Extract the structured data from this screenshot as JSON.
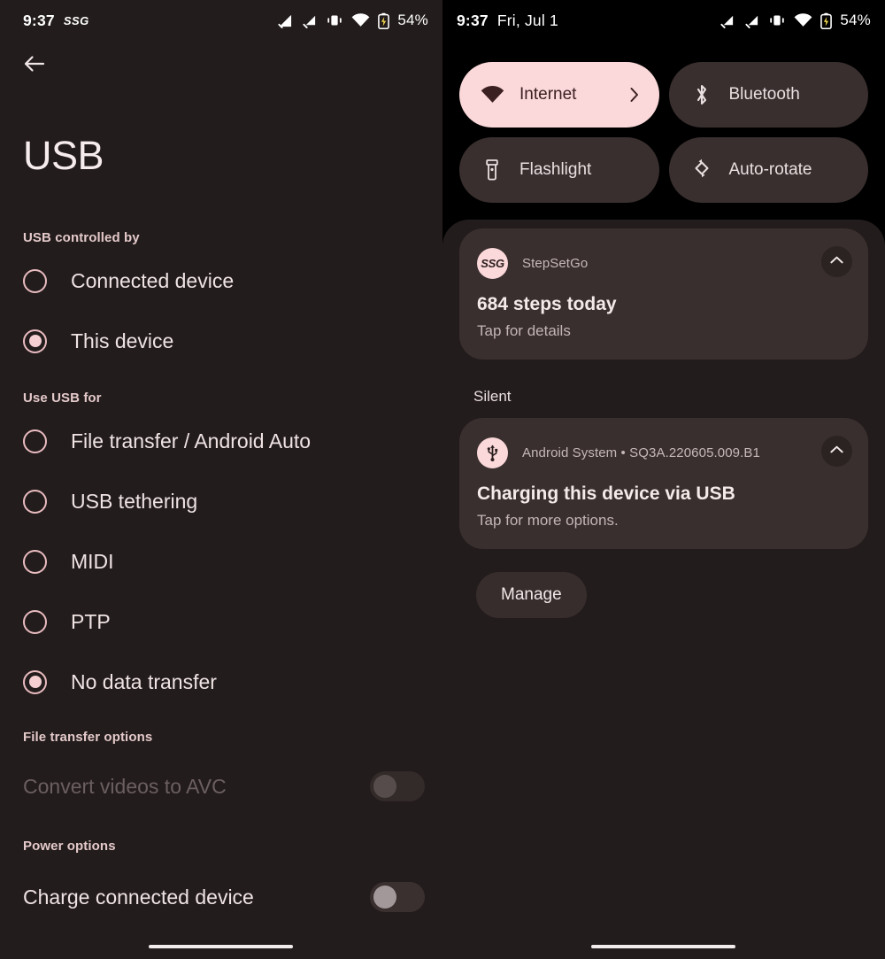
{
  "left": {
    "statusbar": {
      "time": "9:37",
      "app_badge": "SSG",
      "battery": "54%",
      "icons": [
        "signal-icon",
        "signal-icon",
        "vibrate-icon",
        "wifi-icon",
        "battery-charging-icon"
      ]
    },
    "back_icon": "arrow-back-icon",
    "title": "USB",
    "sections": [
      {
        "label": "USB controlled by",
        "options": [
          {
            "label": "Connected device",
            "checked": false
          },
          {
            "label": "This device",
            "checked": true
          }
        ]
      },
      {
        "label": "Use USB for",
        "options": [
          {
            "label": "File transfer / Android Auto",
            "checked": false
          },
          {
            "label": "USB tethering",
            "checked": false
          },
          {
            "label": "MIDI",
            "checked": false
          },
          {
            "label": "PTP",
            "checked": false
          },
          {
            "label": "No data transfer",
            "checked": true
          }
        ]
      }
    ],
    "file_transfer_options": {
      "label": "File transfer options",
      "row": {
        "label": "Convert videos to AVC",
        "enabled": false,
        "on": false
      }
    },
    "power_options": {
      "label": "Power options",
      "row": {
        "label": "Charge connected device",
        "enabled": true,
        "on": false
      }
    }
  },
  "right": {
    "statusbar": {
      "time": "9:37",
      "date": "Fri, Jul 1",
      "battery": "54%",
      "icons": [
        "signal-icon",
        "signal-icon",
        "vibrate-icon",
        "wifi-icon",
        "battery-charging-icon"
      ]
    },
    "tiles": [
      {
        "label": "Internet",
        "icon": "wifi-icon",
        "active": true,
        "chevron": "chevron-right-icon"
      },
      {
        "label": "Bluetooth",
        "icon": "bluetooth-icon",
        "active": false
      },
      {
        "label": "Flashlight",
        "icon": "flashlight-icon",
        "active": false
      },
      {
        "label": "Auto-rotate",
        "icon": "auto-rotate-icon",
        "active": false
      }
    ],
    "notifications": [
      {
        "avatar_text": "SSG",
        "app": "StepSetGo",
        "title": "684 steps today",
        "subtitle": "Tap for details",
        "collapse_icon": "chevron-up-icon"
      }
    ],
    "silent_group_label": "Silent",
    "silent_notifications": [
      {
        "avatar_icon": "usb-icon",
        "app": "Android System  •  SQ3A.220605.009.B1",
        "title": "Charging this device via USB",
        "subtitle": "Tap for more options.",
        "collapse_icon": "chevron-up-icon"
      }
    ],
    "manage_label": "Manage"
  },
  "colors": {
    "surface": "#231c1c",
    "surface_elevated": "#3a2f2f",
    "accent_pink": "#fbd8d9",
    "accent_radio": "#e9bcc0",
    "text_primary": "#efe3e4",
    "text_secondary": "#c3b5b6",
    "text_disabled": "#6b5f60",
    "black": "#000000"
  }
}
